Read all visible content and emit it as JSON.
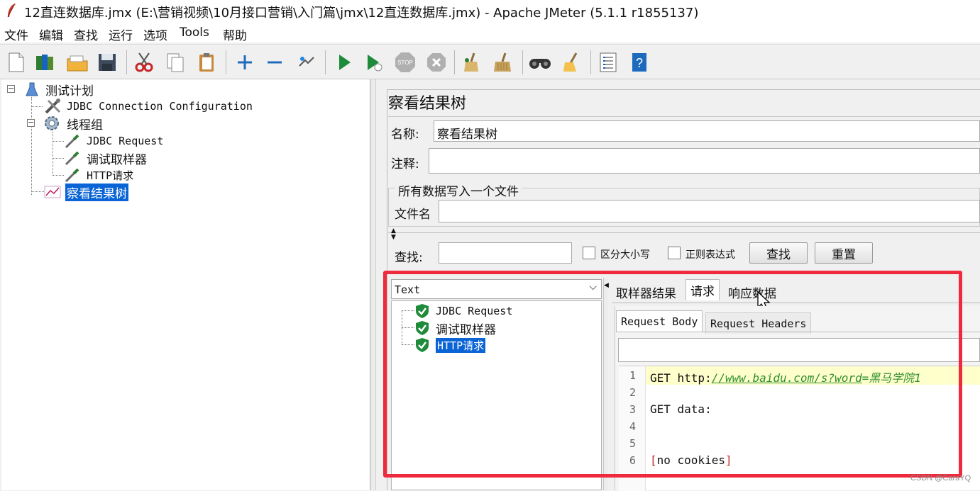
{
  "window": {
    "title": "12直连数据库.jmx (E:\\营销视频\\10月接口营销\\入门篇\\jmx\\12直连数据库.jmx) - Apache JMeter (5.1.1 r1855137)"
  },
  "menu": [
    "文件",
    "编辑",
    "查找",
    "运行",
    "选项",
    "Tools",
    "帮助"
  ],
  "toolbar": {
    "icons": [
      "new-icon",
      "templates-icon",
      "open-icon",
      "save-icon",
      "cut-icon",
      "copy-icon",
      "paste-icon",
      "expand-icon",
      "collapse-icon",
      "toggle-icon",
      "start-icon",
      "start-no-pause-icon",
      "stop-icon",
      "shutdown-icon",
      "clear-icon",
      "clear-all-icon",
      "search-icon",
      "reset-search-icon",
      "function-helper-icon",
      "help-icon"
    ]
  },
  "tree": {
    "test_plan": "测试计划",
    "jdbc_config": "JDBC Connection Configuration",
    "thread_group": "线程组",
    "jdbc_request": "JDBC Request",
    "debug_sampler": "调试取样器",
    "http_request": "HTTP请求",
    "view_results_tree": "察看结果树"
  },
  "panel": {
    "title": "察看结果树",
    "name_label": "名称:",
    "name_value": "察看结果树",
    "comment_label": "注释:",
    "comment_value": "",
    "file_group_title": "所有数据写入一个文件",
    "filename_label": "文件名",
    "filename_value": ""
  },
  "search": {
    "label": "查找:",
    "value": "",
    "case_sensitive": "区分大小写",
    "regex": "正则表达式",
    "find_button": "查找",
    "reset_button": "重置"
  },
  "results": {
    "renderer": "Text",
    "items": [
      "JDBC Request",
      "调试取样器",
      "HTTP请求"
    ],
    "selected_index": 2
  },
  "tabs": {
    "sampler_result": "取样器结果",
    "request": "请求",
    "response_data": "响应数据",
    "active": "请求"
  },
  "subtabs": {
    "request_body": "Request Body",
    "request_headers": "Request Headers"
  },
  "code": {
    "line_numbers": [
      "1",
      "2",
      "3",
      "4",
      "5",
      "6"
    ],
    "line1_method": "GET ",
    "line1_scheme": "http:",
    "line1_link": "//www.baidu.com/s?word",
    "line1_rest": "=黑马学院1",
    "line3": "GET data:",
    "line6_open": "[",
    "line6_text": "no cookies",
    "line6_close": "]"
  },
  "colors": {
    "highlight_box": "#ee2a3c",
    "selection": "#0a64d6",
    "link": "#2f8f2f",
    "current_line": "#ffffcc"
  },
  "watermark": "CSDN @CaraYQ"
}
